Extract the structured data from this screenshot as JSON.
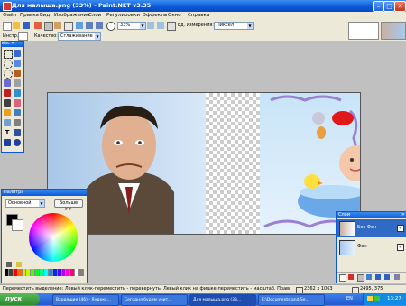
{
  "window": {
    "title": "Для малыша.png (33%) - Paint.NET v3.35",
    "controls": [
      "minimize-icon",
      "maximize-icon",
      "close-icon"
    ]
  },
  "menu": [
    "Файл",
    "Правка",
    "Вид",
    "Изображение",
    "Слои",
    "Регулировки",
    "Эффекты",
    "Окно",
    "Справка"
  ],
  "toolbar": {
    "zoom": "33%",
    "units_label": "Ед. измерения:",
    "units_value": "Пиксел",
    "tool_label": "Инстр.:",
    "quality_label": "Качество:",
    "quality_value": "Сглаживание"
  },
  "tools_window": {
    "title": "Инс ✕"
  },
  "palette": {
    "title": "Палитра",
    "mode": "Основной",
    "more_button": "Больше >>",
    "colors": [
      "#000000",
      "#404040",
      "#ff0000",
      "#ff6a00",
      "#ffd800",
      "#b6ff00",
      "#4cff00",
      "#00ff21",
      "#00ff90",
      "#00ffff",
      "#0094ff",
      "#0026ff",
      "#4800ff",
      "#b200ff",
      "#ff00dc",
      "#ff006e",
      "#ffffff",
      "#808080"
    ]
  },
  "layers": {
    "title": "Слои",
    "items": [
      {
        "name": "Без Фон",
        "selected": true,
        "checked": true
      },
      {
        "name": "Фон",
        "selected": false,
        "checked": true
      }
    ]
  },
  "status": {
    "hint": "Переместить выделение: Левый клик-переместить - перевернуть. Левый клик на фишке-переместить - масштаб. Правый клик-переместить",
    "size": "2362 x 1063",
    "position": "2495, 375"
  },
  "taskbar": {
    "start": "пуск",
    "tasks": [
      "Входящие (46) - Яндекс...",
      "Сегодня будем учит...",
      "Для малыша.png (33...",
      "E:\\Documents and Se..."
    ],
    "lang": "EN",
    "time": "13:27"
  },
  "colors": {
    "accent": "#0a58d8",
    "chrome": "#ece9d8",
    "workspace": "#c0c0c0"
  }
}
